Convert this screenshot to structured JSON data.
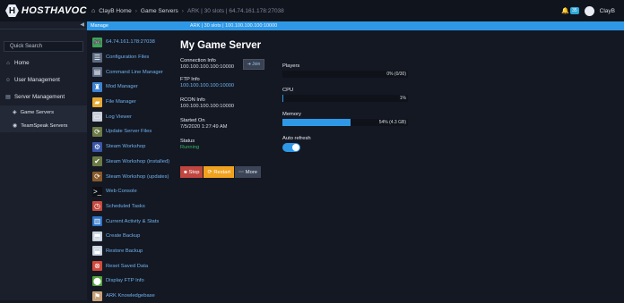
{
  "brand": {
    "name": "HOSTHAVOC",
    "badge": "H"
  },
  "breadcrumb": {
    "home": "ClayB Home",
    "section": "Game Servers",
    "current": "ARK | 30 slots | 64.74.161.178:27038"
  },
  "topbar": {
    "badge_count": "35",
    "user": "ClayB"
  },
  "sidebar": {
    "search_placeholder": "Quick Search",
    "items": [
      {
        "label": "Home",
        "icon": "home-icon"
      },
      {
        "label": "User Management",
        "icon": "users-icon"
      },
      {
        "label": "Server Management",
        "icon": "server-icon"
      }
    ],
    "sub_items": [
      {
        "label": "Game Servers",
        "icon": "gamepad-icon"
      },
      {
        "label": "TeamSpeak Servers",
        "icon": "headset-icon"
      }
    ]
  },
  "manage_bar": {
    "label": "Manage",
    "server": "ARK | 30 slots | 100.100.100.100:10000"
  },
  "tools": [
    {
      "label": "64.74.161.178:27038",
      "icon": "gamepad-icon",
      "color": "#3aa655",
      "glyph": "🎮"
    },
    {
      "label": "Configuration Files",
      "icon": "config-file-icon",
      "color": "#5b6b82",
      "glyph": "☰"
    },
    {
      "label": "Command Line Manager",
      "icon": "command-line-icon",
      "color": "#5b6b82",
      "glyph": "▤"
    },
    {
      "label": "Mod Manager",
      "icon": "mod-icon",
      "color": "#3d82d4",
      "glyph": "♜"
    },
    {
      "label": "File Manager",
      "icon": "folder-icon",
      "color": "#e6a932",
      "glyph": "▰"
    },
    {
      "label": "Log Viewer",
      "icon": "log-icon",
      "color": "#c9ced8",
      "glyph": "▭"
    },
    {
      "label": "Update Server Files",
      "icon": "update-icon",
      "color": "#6c7a46",
      "glyph": "⟳"
    },
    {
      "label": "Steam Workshop",
      "icon": "workshop-icon",
      "color": "#3956a8",
      "glyph": "⚙"
    },
    {
      "label": "Steam Workshop (installed)",
      "icon": "workshop-installed-icon",
      "color": "#6c7a46",
      "glyph": "✔"
    },
    {
      "label": "Steam Workshop (updates)",
      "icon": "workshop-updates-icon",
      "color": "#8a5a2a",
      "glyph": "⟳"
    },
    {
      "label": "Web Console",
      "icon": "console-icon",
      "color": "#0d0f14",
      "glyph": ">_"
    },
    {
      "label": "Scheduled Tasks",
      "icon": "clock-icon",
      "color": "#c64a3f",
      "glyph": "◷"
    },
    {
      "label": "Current Activity & Stats",
      "icon": "stats-icon",
      "color": "#2e73c9",
      "glyph": "▥"
    },
    {
      "label": "Create Backup",
      "icon": "create-backup-icon",
      "color": "#c9d3e0",
      "glyph": "⬒"
    },
    {
      "label": "Restore Backup",
      "icon": "restore-backup-icon",
      "color": "#c9d3e0",
      "glyph": "⬓"
    },
    {
      "label": "Reset Saved Data",
      "icon": "reset-icon",
      "color": "#d24a3c",
      "glyph": "⊗"
    },
    {
      "label": "Display FTP Info",
      "icon": "ftp-icon",
      "color": "#55a33f",
      "glyph": "⬤"
    },
    {
      "label": "ARK Knowledgebase",
      "icon": "knowledgebase-icon",
      "color": "#c7a27a",
      "glyph": "⚑"
    }
  ],
  "server": {
    "title": "My Game Server",
    "connection_label": "Connection Info",
    "connection_value": "100.100.100.100:10000",
    "join_label": "Join",
    "ftp_label": "FTP Info",
    "ftp_value": "100.100.100.100:10000",
    "rcon_label": "RCON Info",
    "rcon_value": "100.100.100.100:10000",
    "started_label": "Started On",
    "started_value": "7/5/2020 1:27:49 AM",
    "status_label": "Status",
    "status_value": "Running"
  },
  "actions": {
    "stop": "Stop",
    "restart": "Restart",
    "more": "More"
  },
  "stats": {
    "players_label": "Players",
    "players_value": "0% (0/30)",
    "players_fraction": 0.0,
    "cpu_label": "CPU",
    "cpu_value": "1%",
    "cpu_fraction": 0.01,
    "memory_label": "Memory",
    "memory_value": "54% (4.3 GB)",
    "memory_fraction": 0.54,
    "auto_refresh_label": "Auto refresh",
    "auto_refresh_on": true
  },
  "colors": {
    "accent": "#2f98e6",
    "running": "#35b85f",
    "stop": "#c0463f",
    "restart": "#f0a21f"
  }
}
